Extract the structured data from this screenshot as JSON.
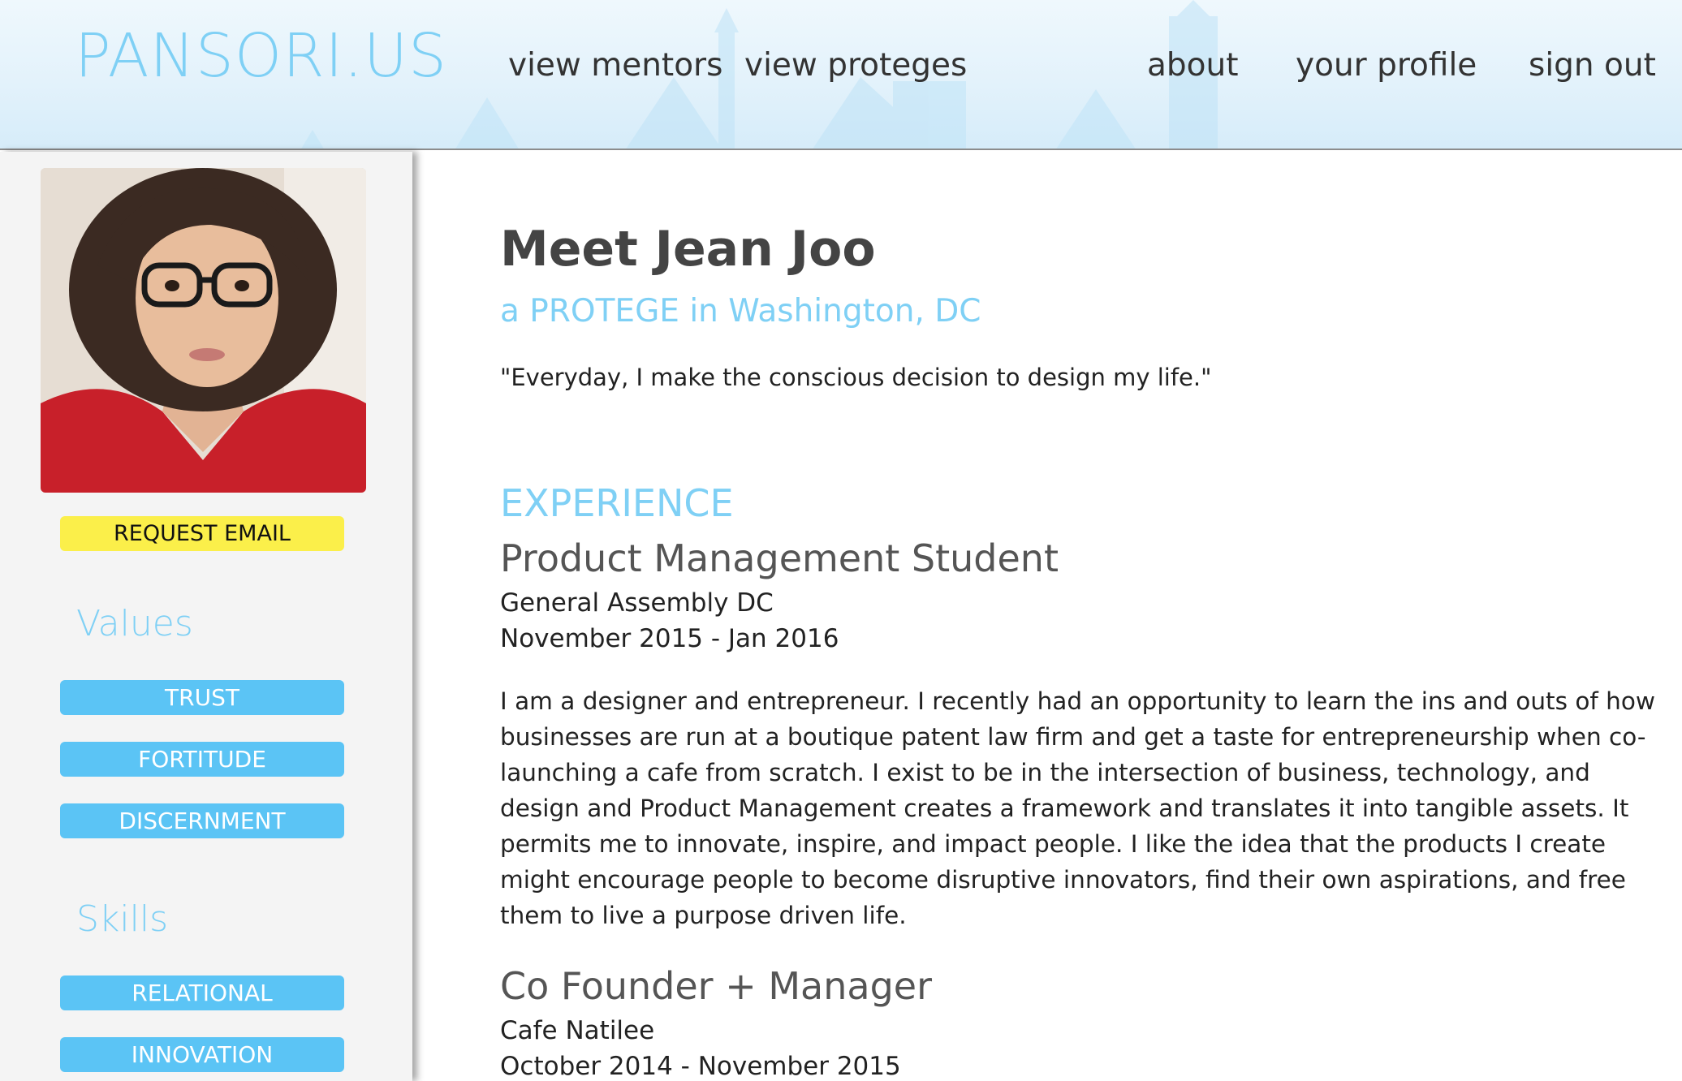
{
  "header": {
    "logo": "PANSORI.US",
    "nav": {
      "view_mentors": "view mentors",
      "view_proteges": "view proteges",
      "about": "about",
      "your_profile": "your profile",
      "sign_out": "sign out"
    }
  },
  "sidebar": {
    "request_email": "REQUEST EMAIL",
    "values_heading": "Values",
    "values": [
      "TRUST",
      "FORTITUDE",
      "DISCERNMENT"
    ],
    "skills_heading": "Skills",
    "skills": [
      "RELATIONAL",
      "INNOVATION"
    ]
  },
  "profile": {
    "title": "Meet Jean Joo",
    "subtitle": "a PROTEGE in Washington, DC",
    "quote": "\"Everyday, I make the conscious decision to design my life.\""
  },
  "experience": {
    "heading": "EXPERIENCE",
    "jobs": [
      {
        "title": "Product Management Student",
        "company": "General Assembly DC",
        "dates": "November 2015 - Jan 2016",
        "description": "I am a designer and entrepreneur. I recently had an opportunity to learn the ins and outs of how businesses are run at a boutique patent law firm and get a taste for entrepreneurship when co-launching a cafe from scratch. I exist to be in the intersection of business, technology, and design and Product Management creates a framework and translates it into tangible assets. It permits me to innovate, inspire, and impact people. I like the idea that the products I create might encourage people to become disruptive innovators, find their own aspirations, and free them to live a purpose driven life."
      },
      {
        "title": "Co Founder + Manager",
        "company": "Cafe Natilee",
        "dates": "October 2014 - November 2015"
      }
    ]
  },
  "colors": {
    "accent_blue": "#7fd0f5",
    "pill_blue": "#5bc4f5",
    "request_yellow": "#fbef4a",
    "text_dark": "#222222"
  },
  "icons": {
    "avatar": "profile-photo"
  }
}
